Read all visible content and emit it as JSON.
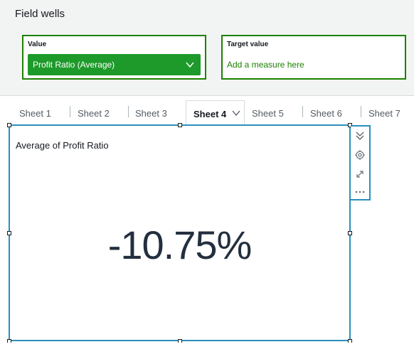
{
  "field_wells": {
    "title": "Field wells",
    "value_well": {
      "label": "Value",
      "field": "Profit Ratio (Average)"
    },
    "target_well": {
      "label": "Target value",
      "placeholder": "Add a measure here"
    }
  },
  "sheets": {
    "tabs": [
      "Sheet 1",
      "Sheet 2",
      "Sheet 3",
      "Sheet 4",
      "Sheet 5",
      "Sheet 6",
      "Sheet 7"
    ],
    "active": "Sheet 4"
  },
  "visual": {
    "title": "Average of Profit Ratio",
    "kpi_value": "-10.75%"
  },
  "toolbar": {
    "icons": [
      "collapse-icon",
      "gear-icon",
      "expand-icon",
      "more-icon"
    ]
  },
  "colors": {
    "well_border": "#1d8102",
    "pill_bg": "#1d9a2a",
    "selection": "#2a8fbd",
    "kpi_text": "#232f3e"
  }
}
